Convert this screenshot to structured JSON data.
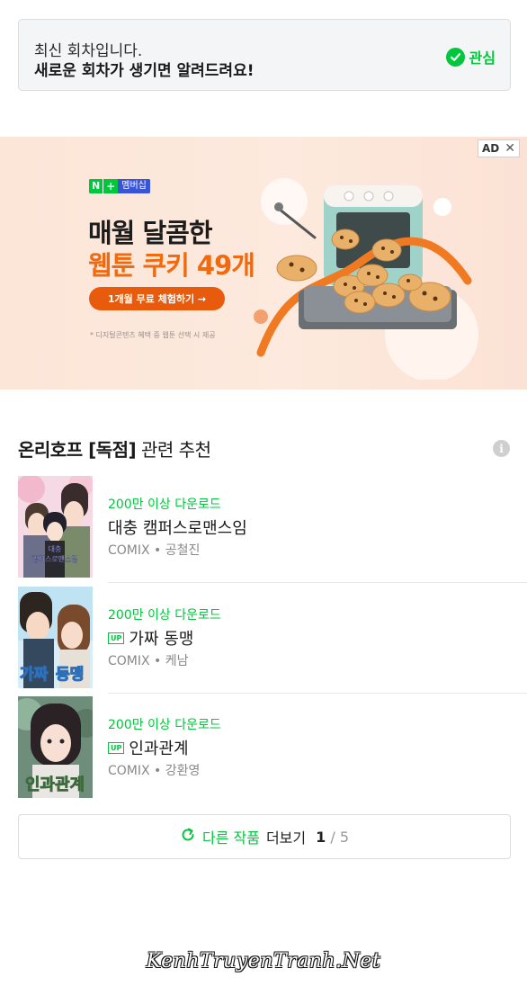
{
  "notice": {
    "line1": "최신 회차입니다.",
    "line2": "새로운 회차가 생기면 알려드려요!",
    "follow_label": "관심",
    "follow_icon": "check-circle-icon"
  },
  "ad": {
    "badge": "AD",
    "close_symbol": "✕",
    "brand_n": "N",
    "brand_plus": "+",
    "brand_membership": "멤버십",
    "headline1": "매월 달콤한",
    "headline2": "웹툰 쿠키 49개",
    "cta": "1개월 무료 체험하기 →",
    "footnote": "* 디지털콘텐츠 혜택 중 웹툰 선택 시 제공"
  },
  "recommend": {
    "title_bold": "온리호프 [독점]",
    "title_rest": " 관련 추천",
    "items": [
      {
        "downloads": "200만 이상 다운로드",
        "up": "",
        "title": "대충 캠퍼스로맨스임",
        "author": "COMIX • 공철진",
        "thumb_text": "대충\n캠퍼스로맨스임"
      },
      {
        "downloads": "200만 이상 다운로드",
        "up": "UP",
        "title": "가짜 동맹",
        "author": "COMIX • 케남",
        "thumb_text": "가짜동맹"
      },
      {
        "downloads": "200만 이상 다운로드",
        "up": "UP",
        "title": "인과관계",
        "author": "COMIX • 강환영",
        "thumb_text": "인과관계"
      }
    ]
  },
  "more": {
    "green_label": "다른 작품",
    "dark_label": "더보기",
    "current_page": "1",
    "total_pages": " / 5"
  },
  "watermark": "KenhTruyenTranh.Net",
  "colors": {
    "accent": "#00c73c",
    "ad_orange": "#f06a12",
    "ad_bg": "#fde9dd"
  }
}
